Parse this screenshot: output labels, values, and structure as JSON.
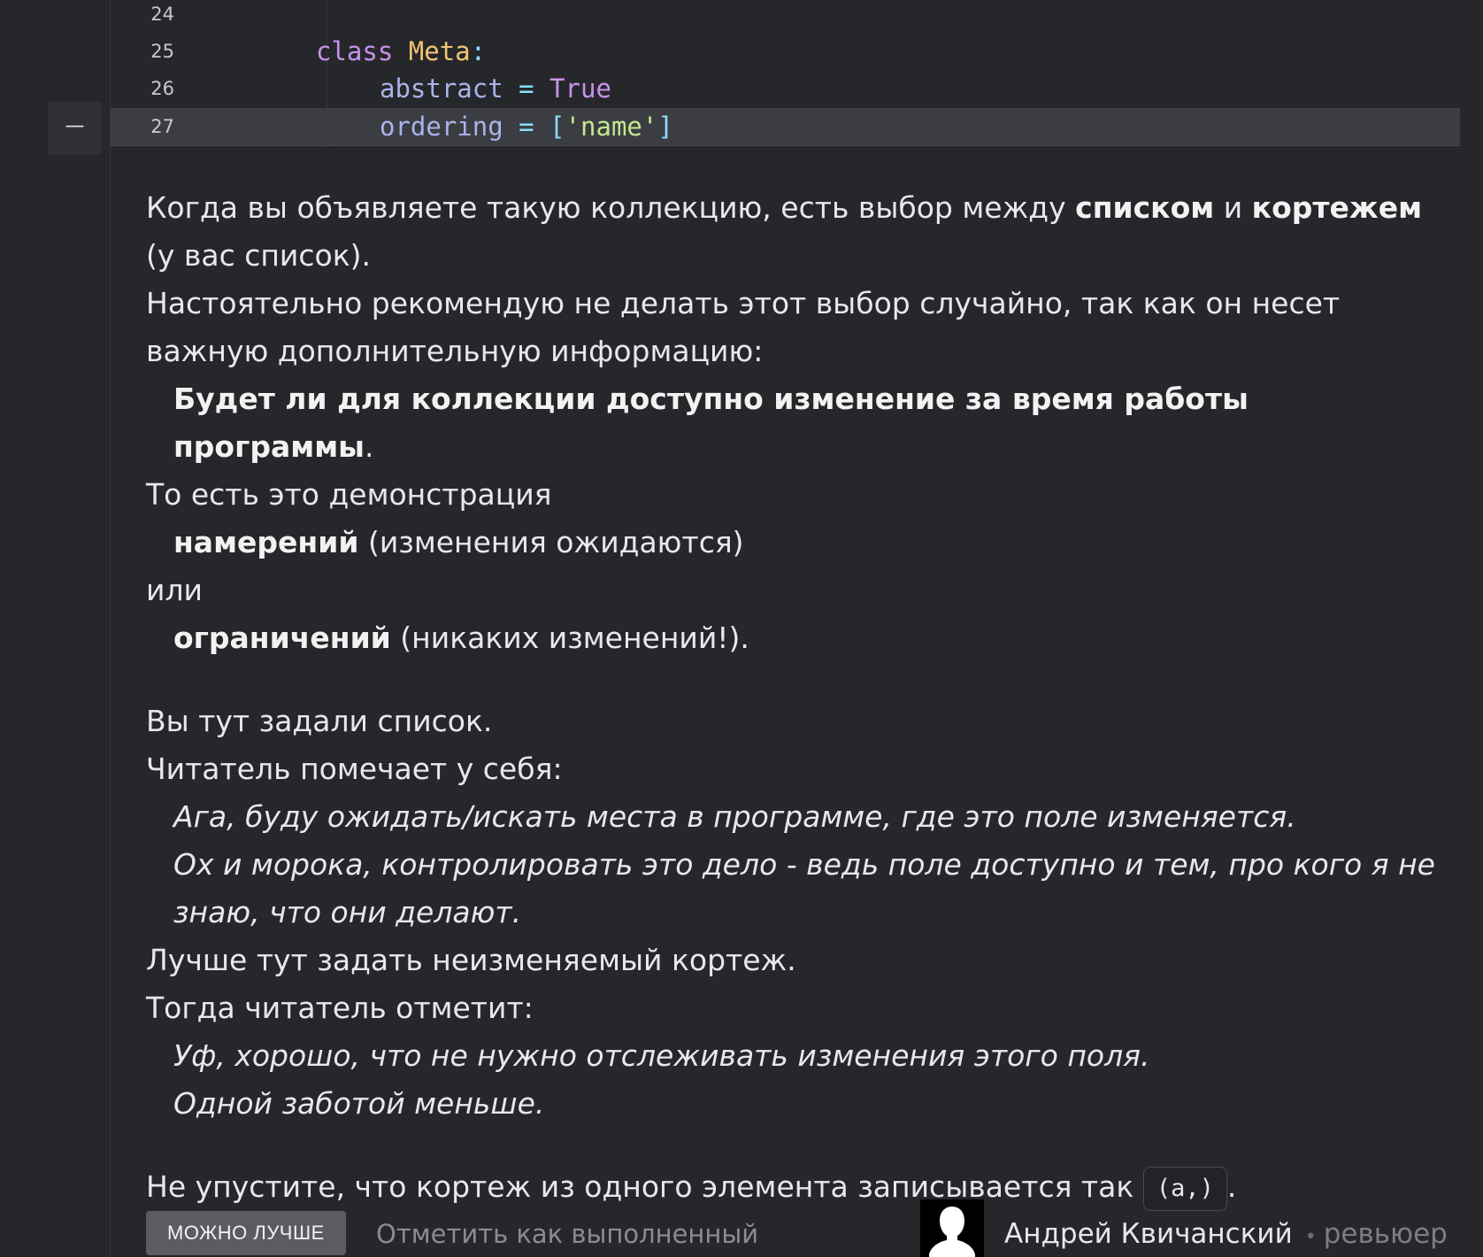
{
  "code": {
    "lines": [
      {
        "number": "24"
      },
      {
        "number": "25",
        "keyword": "class",
        "class_name": "Meta",
        "colon": ":"
      },
      {
        "number": "26",
        "attr": "abstract",
        "op": "=",
        "value": "True"
      },
      {
        "number": "27",
        "attr": "ordering",
        "op": "=",
        "open": "[",
        "string": "'name'",
        "close": "]"
      }
    ]
  },
  "collapse_button": {
    "label": "—"
  },
  "comment": {
    "p1_a": "Когда вы объявляете такую коллекцию, есть выбор между ",
    "p1_b": "списком",
    "p1_c": " и ",
    "p1_d": "кортежем",
    "p1_e": " (у вас список).",
    "p2": "Настоятельно рекомендую не делать этот выбор случайно, так как он несет важную дополнительную информацию:",
    "p3_b": "Будет ли для коллекции доступно изменение за время работы программы",
    "p3_e": ".",
    "p4": "То есть это демонстрация",
    "p5_b": "намерений",
    "p5_e": " (изменения ожидаются)",
    "p6": "или",
    "p7_b": "ограничений",
    "p7_e": " (никаких изменений!).",
    "p8": "Вы тут задали список.",
    "p9": "Читатель помечает у себя:",
    "p10": "Ага, буду ожидать/искать места в программе, где это поле изменяется.",
    "p11": "Ох и морока, контролировать это дело - ведь поле доступно и тем, про кого я не знаю, что они делают.",
    "p12": "Лучше тут задать неизменяемый кортеж.",
    "p13": "Тогда читатель отметит:",
    "p14": "Уф, хорошо, что не нужно отслеживать изменения этого поля.",
    "p15": "Одной заботой меньше.",
    "p16_a": "Не упустите, что кортеж из одного элемента записывается так ",
    "p16_code": "(a,)",
    "p16_e": "."
  },
  "footer": {
    "badge": "МОЖНО ЛУЧШЕ",
    "mark_done": "Отметить как выполненный",
    "author_name": "Андрей Квичанский",
    "separator": "•",
    "author_role": "ревьюер"
  },
  "colors": {
    "background": "#26272b",
    "keyword": "#c792ea",
    "class_name": "#f2c572",
    "string": "#c3e88d",
    "badge": "#5b5c62"
  }
}
